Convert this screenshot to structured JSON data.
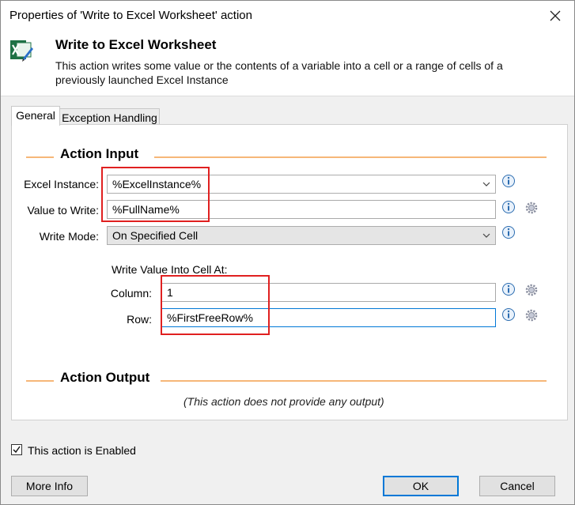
{
  "window": {
    "title": "Properties of 'Write to Excel Worksheet' action"
  },
  "header": {
    "title": "Write to Excel Worksheet",
    "description": "This action writes some value or the contents of a variable into a cell or a range of cells of a previously launched Excel Instance",
    "icon": "excel-write-icon"
  },
  "tabs": [
    {
      "label": "General",
      "selected": true
    },
    {
      "label": "Exception Handling",
      "selected": false
    }
  ],
  "action_input": {
    "title": "Action Input",
    "excel_instance": {
      "label": "Excel Instance:",
      "value": "%ExcelInstance%"
    },
    "value_to_write": {
      "label": "Value to Write:",
      "value": "%FullName%"
    },
    "write_mode": {
      "label": "Write Mode:",
      "value": "On Specified Cell"
    },
    "cell_group_label": "Write Value Into Cell At:",
    "column": {
      "label": "Column:",
      "value": "1"
    },
    "row": {
      "label": "Row:",
      "value": "%FirstFreeRow%"
    }
  },
  "action_output": {
    "title": "Action Output",
    "note": "(This action does not provide any output)"
  },
  "footer": {
    "enabled_label": "This action is Enabled",
    "enabled_checked": true,
    "more_info": "More Info",
    "ok": "OK",
    "cancel": "Cancel"
  },
  "colors": {
    "highlight": "#e02020",
    "section_line": "#f6b778",
    "focus": "#0078d7"
  }
}
